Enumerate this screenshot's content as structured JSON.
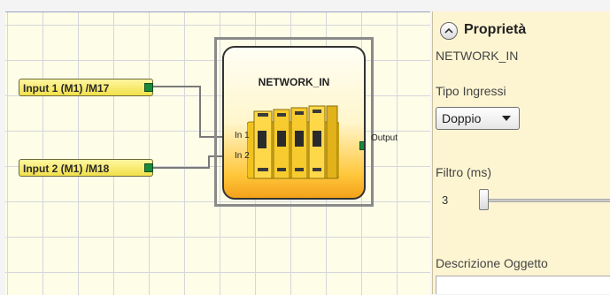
{
  "canvas": {
    "inputs": [
      {
        "label": "Input 1 (M1) /M17"
      },
      {
        "label": "Input 2 (M1) /M18"
      }
    ],
    "function_block": {
      "title": "NETWORK_IN",
      "pins": {
        "in1": "In 1",
        "in2": "In 2",
        "output": "Output"
      }
    }
  },
  "properties": {
    "title": "Proprietà",
    "object_name": "NETWORK_IN",
    "input_type_label": "Tipo Ingressi",
    "input_type_value": "Doppio",
    "filter_label": "Filtro (ms)",
    "filter_value": "3",
    "description_label": "Descrizione Oggetto",
    "description_value": ""
  },
  "colors": {
    "canvas_bg": "#fdfde8",
    "panel_bg": "#fdf5d2",
    "block_accent": "#ffc63a",
    "pin_green": "#1a8a3a",
    "pin_red": "#e0202a"
  },
  "icons": {
    "collapse": "chevron-up-icon",
    "dropdown": "dropdown-arrow-icon"
  }
}
